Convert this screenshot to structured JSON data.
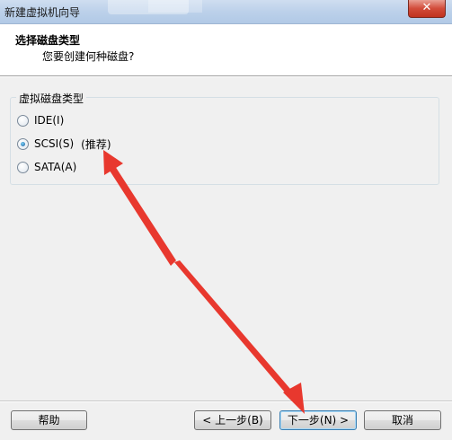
{
  "window": {
    "title": "新建虚拟机向导",
    "close_glyph": "✕"
  },
  "header": {
    "title": "选择磁盘类型",
    "subtitle": "您要创建何种磁盘?"
  },
  "disk_type": {
    "legend": "虚拟磁盘类型",
    "options": [
      {
        "label": "IDE(I)",
        "checked": false
      },
      {
        "label": "SCSI(S)",
        "checked": true,
        "note": "(推荐)"
      },
      {
        "label": "SATA(A)",
        "checked": false
      }
    ]
  },
  "buttons": {
    "help": "帮助",
    "back": "< 上一步(B)",
    "next": "下一步(N) >",
    "cancel": "取消"
  },
  "annotation": {
    "arrow_color": "#e8382e"
  }
}
